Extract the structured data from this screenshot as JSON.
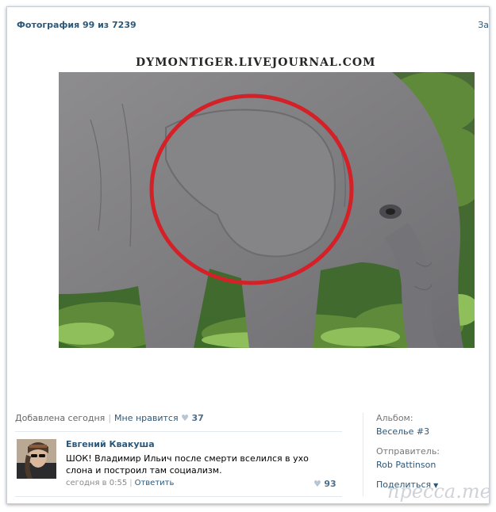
{
  "header": {
    "title": "Фотография 99 из 7239",
    "close_label": "За"
  },
  "photo": {
    "watermark": "DYMONTIGER.LIVEJOURNAL.COM"
  },
  "info_bar": {
    "added": "Добавлена сегодня",
    "like_label": "Мне нравится",
    "like_count": "37"
  },
  "comment": {
    "author": "Евгений Квакуша",
    "text": "ШОК! Владимир Ильич после смерти вселился в ухо слона и построил там социализм.",
    "time": "сегодня в 0:55",
    "reply_label": "Ответить",
    "likes": "93"
  },
  "sidebar": {
    "album_label": "Альбом:",
    "album_name": "Веселье #3",
    "sender_label": "Отправитель:",
    "sender_name": "Rob Pattinson",
    "share_label": "Поделиться"
  },
  "site_watermark": "пресса.те",
  "colors": {
    "link": "#2b587a",
    "heart": "#b7c5d4",
    "circle": "#d42027"
  },
  "icons": [
    "heart-icon",
    "chevron-down-icon",
    "close-icon"
  ]
}
